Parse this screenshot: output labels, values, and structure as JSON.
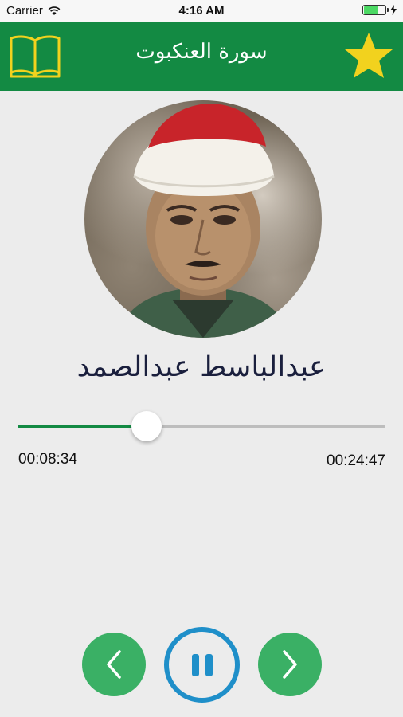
{
  "status_bar": {
    "carrier": "Carrier",
    "time": "4:16 AM",
    "battery_level": 0.7,
    "battery_color": "#4cd964"
  },
  "nav": {
    "title": "سورة العنكبوت",
    "left_icon": "book-icon",
    "right_icon": "star-icon",
    "background_color": "#138a43",
    "icon_color": "#f2d21e"
  },
  "reciter": {
    "name": "عبدالباسط عبدالصمد"
  },
  "player": {
    "elapsed": "00:08:34",
    "total": "00:24:47",
    "progress": 0.35,
    "controls": {
      "prev_icon": "chevron-left-icon",
      "play_icon": "pause-icon",
      "next_icon": "chevron-right-icon",
      "green": "#3ab065",
      "blue": "#1f8fc9"
    }
  }
}
